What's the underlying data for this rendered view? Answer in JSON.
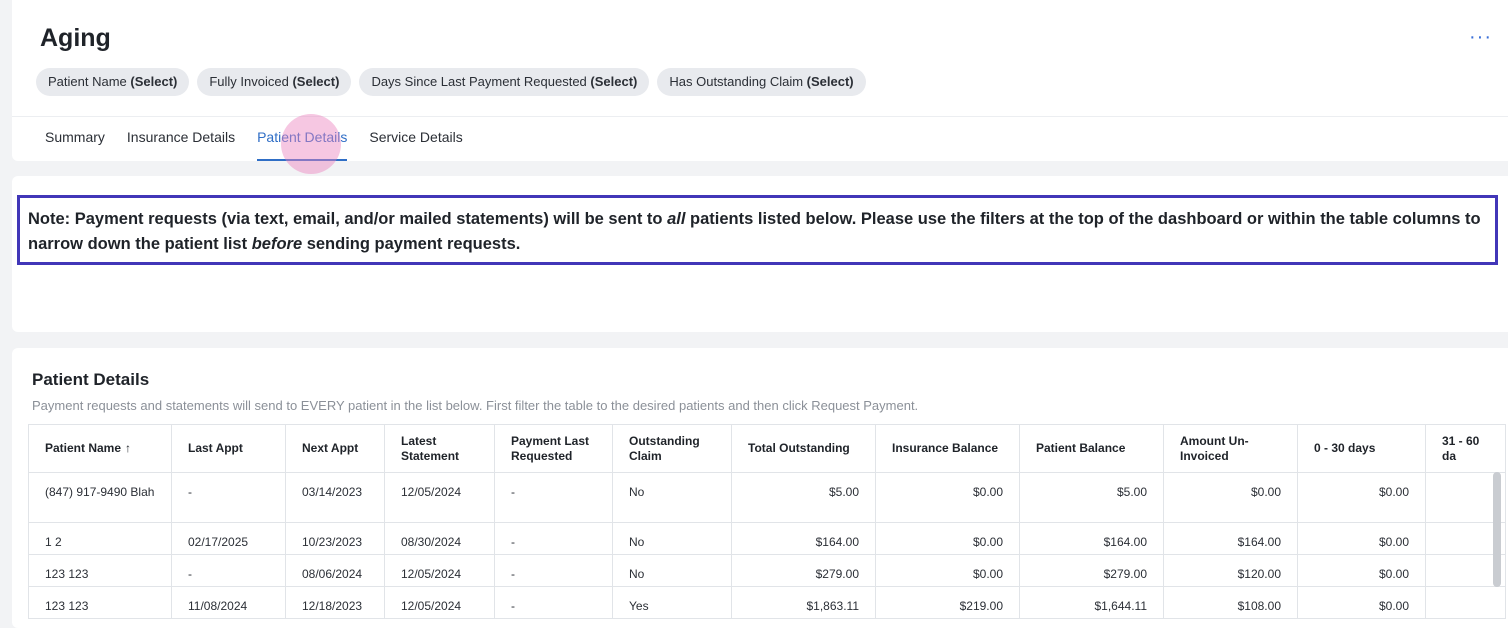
{
  "page": {
    "title": "Aging",
    "more_label": "···"
  },
  "filters": [
    {
      "name": "Patient Name",
      "value": "(Select)"
    },
    {
      "name": "Fully Invoiced",
      "value": "(Select)"
    },
    {
      "name": "Days Since Last Payment Requested",
      "value": "(Select)"
    },
    {
      "name": "Has Outstanding Claim",
      "value": "(Select)"
    }
  ],
  "tabs": [
    {
      "label": "Summary",
      "active": false
    },
    {
      "label": "Insurance Details",
      "active": false
    },
    {
      "label": "Patient Details",
      "active": true
    },
    {
      "label": "Service Details",
      "active": false
    }
  ],
  "note": {
    "part1": "Note: Payment requests (via text, email, and/or mailed statements) will be sent to ",
    "em1": "all",
    "part2": " patients listed below. Please use the filters at the top of the dashboard or within the table columns to narrow down the patient list ",
    "em2": "before",
    "part3": " sending payment requests."
  },
  "patient_details": {
    "title": "Patient Details",
    "subtitle": "Payment requests and statements will send to EVERY patient in the list below. First filter the table to the desired patients and then click Request Payment.",
    "sort_icon": "↑",
    "columns": [
      "Patient Name",
      "Last Appt",
      "Next Appt",
      "Latest Statement",
      "Payment Last Requested",
      "Outstanding Claim",
      "Total Outstanding",
      "Insurance Balance",
      "Patient Balance",
      "Amount Un-Invoiced",
      "0 - 30 days",
      "31 - 60 da"
    ],
    "rows": [
      [
        "(847) 917-9490 Blah",
        "-",
        "03/14/2023",
        "12/05/2024",
        "-",
        "No",
        "$5.00",
        "$0.00",
        "$5.00",
        "$0.00",
        "$0.00",
        ""
      ],
      [
        "1 2",
        "02/17/2025",
        "10/23/2023",
        "08/30/2024",
        "-",
        "No",
        "$164.00",
        "$0.00",
        "$164.00",
        "$164.00",
        "$0.00",
        ""
      ],
      [
        "123 123",
        "-",
        "08/06/2024",
        "12/05/2024",
        "-",
        "No",
        "$279.00",
        "$0.00",
        "$279.00",
        "$120.00",
        "$0.00",
        ""
      ],
      [
        "123 123",
        "11/08/2024",
        "12/18/2023",
        "12/05/2024",
        "-",
        "Yes",
        "$1,863.11",
        "$219.00",
        "$1,644.11",
        "$108.00",
        "$0.00",
        ""
      ]
    ]
  },
  "colors": {
    "accent": "#2f6ec6",
    "note_border": "#4136b8",
    "chip_bg": "#e8eaee"
  }
}
